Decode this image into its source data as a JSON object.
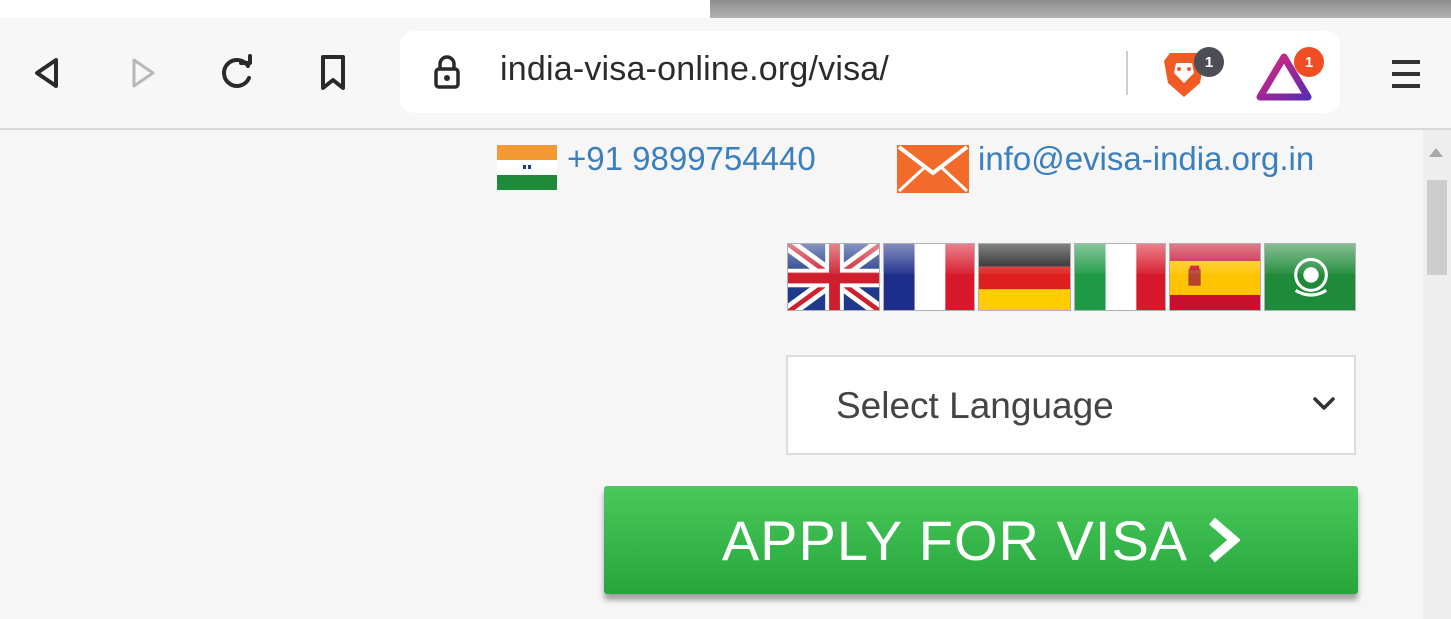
{
  "browser": {
    "url": "india-visa-online.org/visa/",
    "brave_shield_badge": "1",
    "rewards_badge": "1"
  },
  "contact": {
    "phone": "+91 9899754440",
    "email": "info@evisa-india.org.in"
  },
  "languages": {
    "flags": [
      "uk-flag",
      "france-flag",
      "germany-flag",
      "italy-flag",
      "spain-flag",
      "arabic-flag"
    ],
    "select_label": "Select Language"
  },
  "cta": {
    "label": "APPLY FOR VISA"
  },
  "colors": {
    "link": "#3a7fbe",
    "button_green": "#3cb84e",
    "badge": "#f04d23"
  }
}
